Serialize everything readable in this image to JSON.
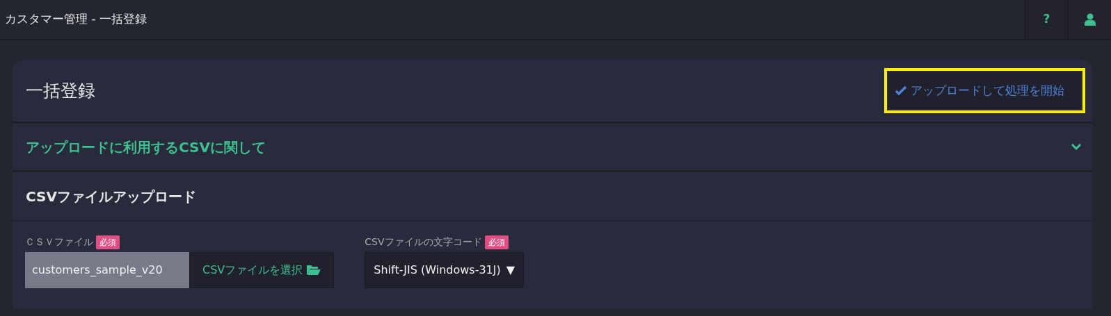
{
  "header": {
    "title": "カスタマー管理 - 一括登録",
    "buttons": [
      {
        "kind": "help",
        "label": "?"
      },
      {
        "kind": "user"
      }
    ]
  },
  "card": {
    "title": "一括登録",
    "highlighted": true,
    "action": {
      "label": "アップロードして処理を開始"
    }
  },
  "accordion": {
    "title": "アップロードに利用するCSVに関して",
    "expanded": false
  },
  "section": {
    "title": "CSVファイルアップロード"
  },
  "fields": [
    {
      "kind": "file",
      "label": "ＣＳＶファイル",
      "badge": "必須",
      "value": "customers_sample_v20",
      "button": "CSVファイルを選択"
    },
    {
      "kind": "select",
      "label": "CSVファイルの文字コード",
      "badge": "必須",
      "value": "Shift-JIS (Windows-31J)",
      "caret": "▼"
    }
  ]
}
